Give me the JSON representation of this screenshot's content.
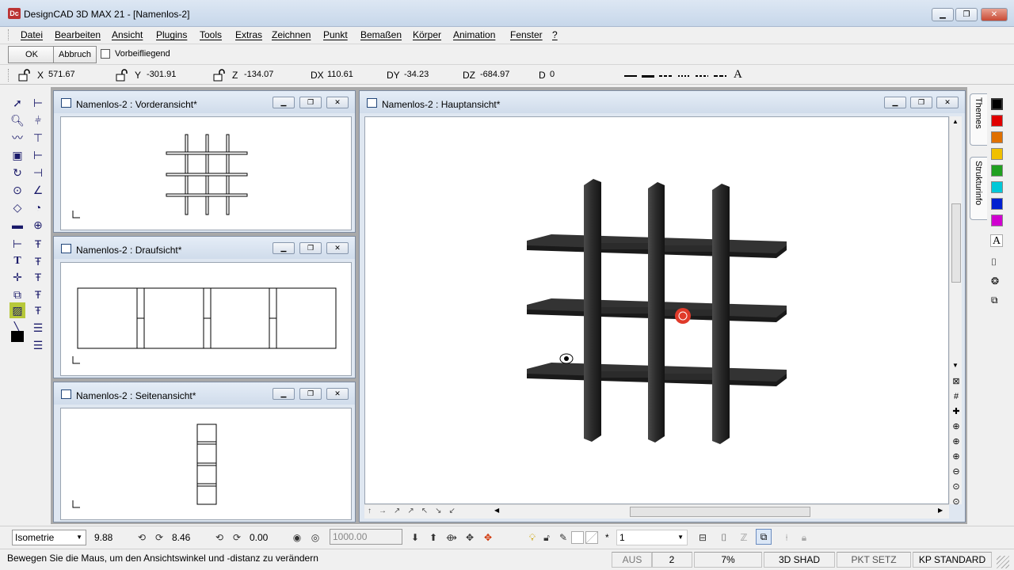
{
  "app": {
    "title": "DesignCAD 3D MAX 21 - [Namenlos-2]",
    "icon_name": "designcad-app-icon",
    "window_buttons": {
      "minimize": "▁",
      "restore": "❐",
      "close": "✕"
    }
  },
  "menu": [
    "Datei",
    "Bearbeiten",
    "Ansicht",
    "Plugins",
    "Tools",
    "Extras",
    "Zeichnen",
    "Punkt",
    "Bemaßen",
    "Körper",
    "Animation",
    "Fenster",
    "?"
  ],
  "command": {
    "ok_label": "OK",
    "cancel_label": "Abbruch",
    "option_label": "Vorbeifliegend",
    "option_checked": false
  },
  "coords": {
    "x_label": "X",
    "x_value": "571.67",
    "y_label": "Y",
    "y_value": "-301.91",
    "z_label": "Z",
    "z_value": "-134.07",
    "dx_label": "DX",
    "dx_value": "110.61",
    "dy_label": "DY",
    "dy_value": "-34.23",
    "dz_label": "DZ",
    "dz_value": "-684.97",
    "d_label": "D",
    "d_value": "0",
    "text_tool_glyph": "A"
  },
  "views": {
    "front": {
      "title": "Namenlos-2 : Vorderansicht*"
    },
    "top": {
      "title": "Namenlos-2 : Draufsicht*"
    },
    "side": {
      "title": "Namenlos-2 : Seitenansicht*"
    },
    "main": {
      "title": "Namenlos-2 : Hauptansicht*"
    }
  },
  "side_tabs": {
    "themes": "Themes",
    "struktur": "Strukturinfo"
  },
  "colors": [
    "#000000",
    "#e00000",
    "#e07000",
    "#f0c000",
    "#20a020",
    "#00c8d8",
    "#0020d0",
    "#d000d0"
  ],
  "bottom": {
    "view_mode": "Isometrie",
    "angle_a": "9.88",
    "angle_b": "8.46",
    "angle_c": "0.00",
    "distance": "1000.00",
    "star": "*",
    "layer": "1"
  },
  "status": {
    "message": "Bewegen Sie die Maus, um den Ansichtswinkel und -distanz zu verändern",
    "aus": "AUS",
    "count": "2",
    "zoom": "7%",
    "shade": "3D SHAD",
    "pkt": "PKT SETZ",
    "kp": "KP STANDARD"
  }
}
